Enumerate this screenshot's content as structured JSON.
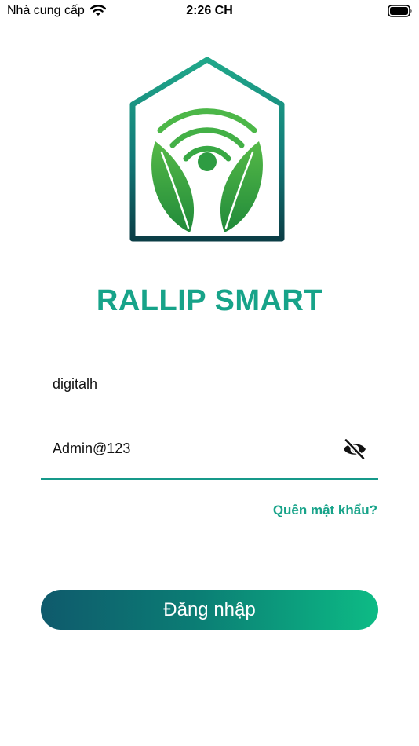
{
  "status_bar": {
    "carrier": "Nhà cung cấp",
    "time": "2:26 CH",
    "wifi_icon": "wifi-icon",
    "battery_icon": "battery-icon"
  },
  "app": {
    "title": "RALLIP SMART",
    "logo_icon": "house-leaf-wifi-logo",
    "brand_color": "#17a389"
  },
  "login_form": {
    "username_value": "digitalh",
    "password_value": "Admin@123",
    "password_toggle_icon": "eye-slash-icon",
    "forgot_password_label": "Quên mật khẩu?",
    "login_button_label": "Đăng nhập"
  },
  "colors": {
    "accent": "#17a389",
    "button_gradient_start": "#0f5a6c",
    "button_gradient_end": "#0dbb85"
  }
}
